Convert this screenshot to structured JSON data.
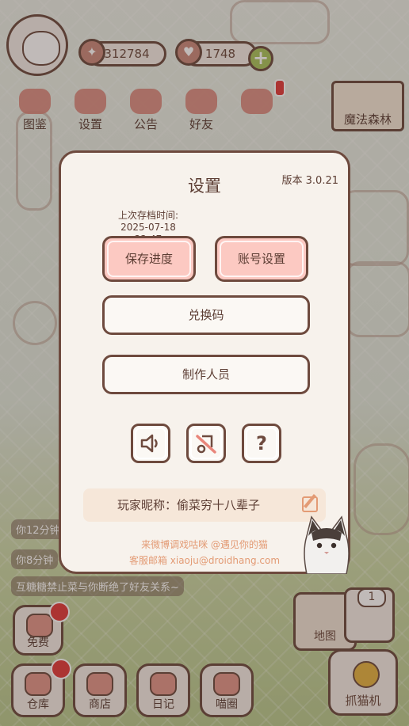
{
  "background": {
    "coins": "312784",
    "hearts": "1748",
    "top_nav": [
      "图鉴",
      "设置",
      "公告",
      "好友"
    ],
    "forest_sign": "魔法森林",
    "hints": [
      "你12分钟",
      "你8分钟",
      "互糖糖禁止菜与你断绝了好友关系~"
    ],
    "free_label": "免费",
    "bottom_nav": [
      "仓库",
      "商店",
      "日记",
      "喵圈"
    ],
    "map_label": "地图",
    "claw_label": "抓猫机",
    "machine_count": "1"
  },
  "modal": {
    "title": "设置",
    "version": "版本 3.0.21",
    "last_save_label": "上次存档时间:",
    "last_save_time": "2025-07-18 22:47",
    "save_button": "保存进度",
    "account_button": "账号设置",
    "redeem_button": "兑换码",
    "credits_button": "制作人员",
    "nickname_text": "玩家昵称：偷菜穷十八辈子",
    "weibo_text": "来微博调戏咕咪 @遇见你的猫",
    "email_text": "客服邮箱 xiaoju@droidhang.com"
  },
  "colors": {
    "accent_pink": "#fcc9c2",
    "border_brown": "#6e4a3e",
    "link_orange": "#e39b75"
  }
}
